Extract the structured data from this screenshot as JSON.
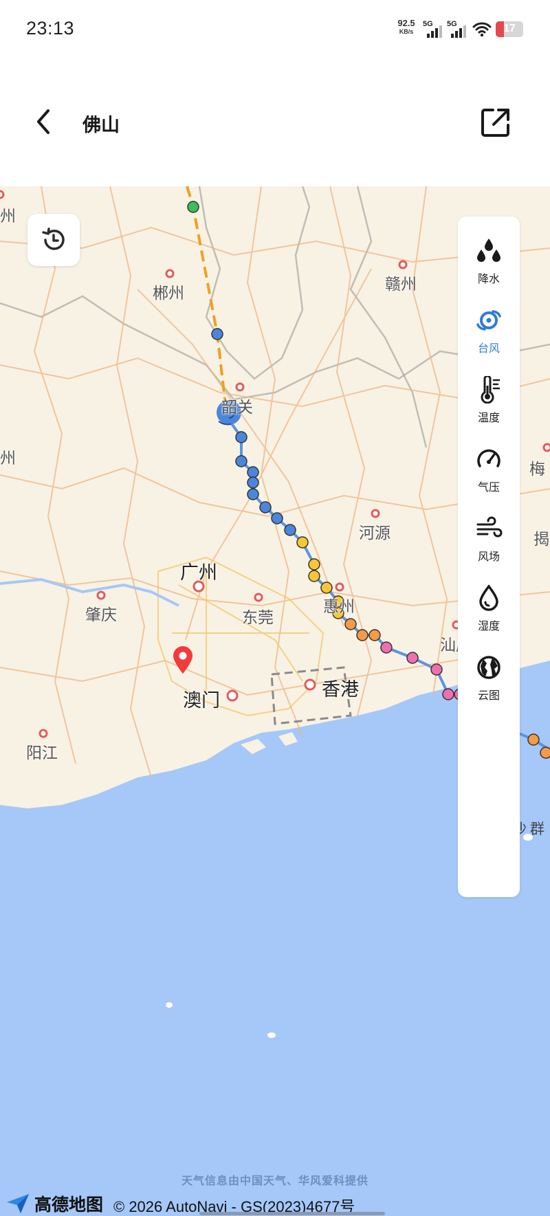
{
  "status_bar": {
    "time": "23:13",
    "net_speed_value": "92.5",
    "net_speed_unit": "KB/s",
    "sim1_label": "5G",
    "sim2_label": "5G",
    "battery_level": "17"
  },
  "header": {
    "title": "佛山",
    "back_icon": "chevron-left-icon",
    "share_icon": "external-link-icon"
  },
  "map": {
    "history_icon": "history-icon",
    "cities": {
      "chenzhou": "郴州",
      "ganzhou": "赣州",
      "shaoguan": "韶关",
      "heyuan": "河源",
      "guangzhou": "广州",
      "zhaoqing": "肇庆",
      "dongguan": "东莞",
      "huizhou": "惠州",
      "shanwei": "汕尾",
      "xianggang": "香港",
      "aomen": "澳门",
      "yangjiang": "阳江",
      "dongsha": "东沙群",
      "mei_partial": "梅",
      "jie_partial": "揭",
      "left_partial_1": "州",
      "left_partial_2": "州"
    },
    "layers": [
      {
        "label": "降水",
        "icon": "rain-drops-icon",
        "active": false
      },
      {
        "label": "台风",
        "icon": "typhoon-icon",
        "active": true
      },
      {
        "label": "温度",
        "icon": "thermometer-icon",
        "active": false
      },
      {
        "label": "气压",
        "icon": "gauge-icon",
        "active": false
      },
      {
        "label": "风场",
        "icon": "wind-icon",
        "active": false
      },
      {
        "label": "湿度",
        "icon": "droplet-icon",
        "active": false
      },
      {
        "label": "云图",
        "icon": "globe-icon",
        "active": false
      }
    ],
    "location_pin_icon": "location-pin-icon",
    "typhoon_icon": "typhoon-center-icon",
    "colors": {
      "track_line": "#5b95e0",
      "forecast_line": "#f0a020",
      "sea": "#a5c8f8",
      "land": "#f8f2e4",
      "active_layer": "#2f7bd8"
    }
  },
  "footer": {
    "attribution": "天气信息由中国天气、华风爱科提供",
    "logo_text": "高德地图",
    "copyright": "© 2026 AutoNavi - GS(2023)4677号"
  }
}
